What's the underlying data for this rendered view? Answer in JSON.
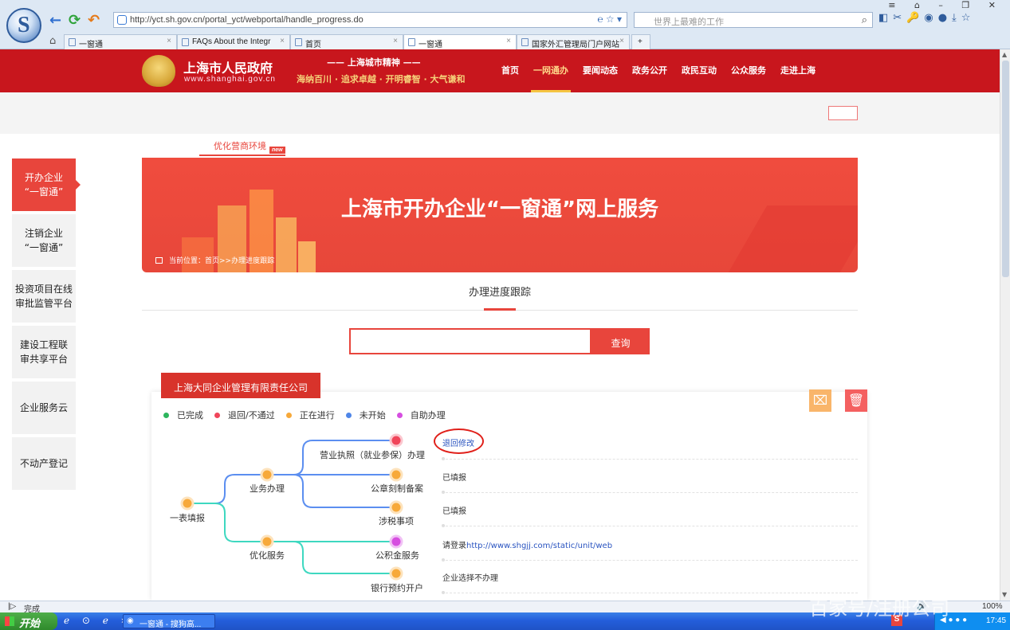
{
  "browser": {
    "url": "http://yct.sh.gov.cn/portal_yct/webportal/handle_progress.do",
    "search_placeholder": "世界上最难的工作",
    "tabs": [
      {
        "label": "一窗通",
        "active": false
      },
      {
        "label": "FAQs About the Integr",
        "active": false
      },
      {
        "label": "首页",
        "active": false
      },
      {
        "label": "一窗通",
        "active": true
      },
      {
        "label": "国家外汇管理局门户网站",
        "active": false
      }
    ],
    "new_tab": "+"
  },
  "site": {
    "name": "上海市人民政府",
    "url": "www.shanghai.gov.cn",
    "spirit_title": "—— 上海城市精神 ——",
    "spirit_text": "海纳百川 · 追求卓越 · 开明睿智 · 大气谦和",
    "nav": [
      "首页",
      "一网通办",
      "要闻动态",
      "政务公开",
      "政民互动",
      "公众服务",
      "走进上海"
    ],
    "nav_active": "一网通办"
  },
  "sidebar": {
    "items": [
      {
        "label": "开办企业\n“一窗通”",
        "active": true
      },
      {
        "label": "注销企业\n“一窗通”",
        "active": false
      },
      {
        "label": "投资项目在线\n审批监管平台",
        "active": false
      },
      {
        "label": "建设工程联\n审共享平台",
        "active": false
      },
      {
        "label": "企业服务云",
        "active": false
      },
      {
        "label": "不动产登记",
        "active": false
      }
    ]
  },
  "banner": {
    "optimize_label": "优化营商环境",
    "new_badge": "new",
    "title": "上海市开办企业“一窗通”网上服务",
    "breadcrumb": "当前位置：首页>>办理进度跟踪"
  },
  "progress": {
    "section_title": "办理进度跟踪",
    "query_value": "",
    "query_button": "查询",
    "company": "上海大同企业管理有限责任公司",
    "legend": [
      {
        "label": "已完成",
        "color": "#2db55d"
      },
      {
        "label": "退回/不通过",
        "color": "#f0455a"
      },
      {
        "label": "正在进行",
        "color": "#f7a93a"
      },
      {
        "label": "未开始",
        "color": "#4f86e8"
      },
      {
        "label": "自助办理",
        "color": "#d64ee0"
      }
    ],
    "tree": {
      "root": "一表填报",
      "branches": [
        {
          "label": "业务办理",
          "color": "#5b8ef0",
          "children": [
            {
              "label": "营业执照（就业参保）办理",
              "status_color": "#f0455a"
            },
            {
              "label": "公章刻制备案",
              "status_color": "#f7a93a"
            },
            {
              "label": "涉税事项",
              "status_color": "#f7a93a"
            }
          ]
        },
        {
          "label": "优化服务",
          "color": "#3ed8c0",
          "children": [
            {
              "label": "公积金服务",
              "status_color": "#d64ee0"
            },
            {
              "label": "银行预约开户",
              "status_color": "#f7a93a"
            }
          ]
        }
      ]
    },
    "statuses": [
      {
        "prefix": "",
        "link": "退回修改"
      },
      {
        "prefix": "已填报",
        "link": ""
      },
      {
        "prefix": "已填报",
        "link": ""
      },
      {
        "prefix": "请登录",
        "link": "http://www.shgjj.com/static/unit/web"
      },
      {
        "prefix": "企业选择不办理",
        "link": ""
      }
    ]
  },
  "statusbar": {
    "text": "完成",
    "zoom": "100%"
  },
  "taskbar": {
    "start": "开始",
    "task": "一窗通 - 搜狗高...",
    "time": "17:45"
  },
  "watermark": "百家号/注册公司"
}
